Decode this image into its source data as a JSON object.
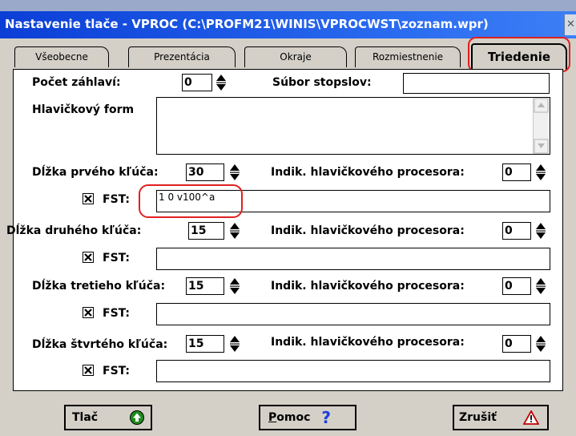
{
  "window": {
    "title": "Nastavenie tlače - VPROC (C:\\PROFM21\\WINIS\\VPROCWST\\zoznam.wpr)",
    "close_glyph": "✕"
  },
  "tabs": [
    {
      "label": "Všeobecne",
      "active": false
    },
    {
      "label": "Prezentácia",
      "active": false
    },
    {
      "label": "Okraje",
      "active": false
    },
    {
      "label": "Rozmiestnenie",
      "active": false
    },
    {
      "label": "Triedenie",
      "active": true
    }
  ],
  "form": {
    "pocet_zahlavi_label": "Počet záhlaví:",
    "pocet_zahlavi_value": "0",
    "subor_stopslov_label": "Súbor stopslov:",
    "subor_stopslov_value": "",
    "hlavickovy_form_label": "Hlavičkový form",
    "keys": [
      {
        "length_label": "Dĺžka prvého kľúča:",
        "length_value": "30",
        "indik_label": "Indik. hlavičkového procesora:",
        "indik_value": "0",
        "fst_label": "FST:",
        "fst_checked": true,
        "fst_value": "1 0 v100^a"
      },
      {
        "length_label": "Dĺžka druhého kľúča:",
        "length_value": "15",
        "indik_label": "Indik. hlavičkového procesora:",
        "indik_value": "0",
        "fst_label": "FST:",
        "fst_checked": true,
        "fst_value": ""
      },
      {
        "length_label": "Dĺžka tretieho kľúča:",
        "length_value": "15",
        "indik_label": "Indik. hlavičkového procesora:",
        "indik_value": "0",
        "fst_label": "FST:",
        "fst_checked": true,
        "fst_value": ""
      },
      {
        "length_label": "Dĺžka štvrtého kľúča:",
        "length_value": "15",
        "indik_label": "Indik. hlavičkového procesora:",
        "indik_value": "0",
        "fst_label": "FST:",
        "fst_checked": true,
        "fst_value": ""
      }
    ]
  },
  "buttons": {
    "print_label": "Tlač",
    "help_label": "Pomoc",
    "help_glyph": "?",
    "cancel_label": "Zrušiť",
    "cancel_glyph": "⚠"
  },
  "colors": {
    "title_bar": "#0b3ed6",
    "dialog_face": "#d4d0c8",
    "highlight_outline": "#e02020",
    "print_icon_green": "#1f8a1f",
    "help_icon_blue": "#1a3fe0"
  },
  "icons": {
    "checkbox": "checkbox-checked-icon",
    "spinner": "spinner-updown-icon",
    "print": "green-arrow-up-icon",
    "help": "question-mark-icon",
    "cancel": "warning-triangle-icon"
  }
}
